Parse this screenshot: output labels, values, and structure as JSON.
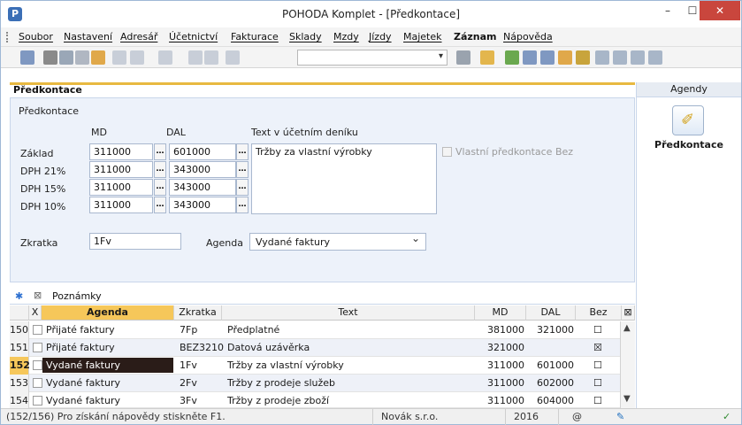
{
  "window": {
    "title": "POHODA Komplet - [Předkontace]",
    "min_label": "–",
    "max_label": "☐",
    "close_label": "✕"
  },
  "menu": [
    {
      "label": "Soubor"
    },
    {
      "label": "Nastavení"
    },
    {
      "label": "Adresář"
    },
    {
      "label": "Účetnictví"
    },
    {
      "label": "Fakturace"
    },
    {
      "label": "Sklady"
    },
    {
      "label": "Mzdy"
    },
    {
      "label": "Jízdy"
    },
    {
      "label": "Majetek"
    },
    {
      "label": "Záznam"
    },
    {
      "label": "Nápověda"
    }
  ],
  "section": {
    "title": "Předkontace",
    "subtitle": "Předkontace"
  },
  "form": {
    "col_md": "MD",
    "col_dal": "DAL",
    "col_text": "Text v účetním deníku",
    "rows": [
      {
        "label": "Základ",
        "md": "311000",
        "dal": "601000"
      },
      {
        "label": "DPH 21%",
        "md": "311000",
        "dal": "343000"
      },
      {
        "label": "DPH 15%",
        "md": "311000",
        "dal": "343000"
      },
      {
        "label": "DPH 10%",
        "md": "311000",
        "dal": "343000"
      }
    ],
    "text_value": "Tržby za vlastní výrobky",
    "own_bez_label": "Vlastní předkontace Bez",
    "zkratka_label": "Zkratka",
    "zkratka_value": "1Fv",
    "agenda_label": "Agenda",
    "agenda_value": "Vydané faktury",
    "dots": "…"
  },
  "sidebar": {
    "header": "Agendy",
    "item_label": "Předkontace"
  },
  "grid_tabs": {
    "star": "✱",
    "notes_label": "Poznámky"
  },
  "grid": {
    "headers": {
      "x": "X",
      "agenda": "Agenda",
      "zkratka": "Zkratka",
      "text": "Text",
      "md": "MD",
      "dal": "DAL",
      "bez": "Bez",
      "corner": "⊠"
    },
    "rows": [
      {
        "num": "150",
        "agenda": "Přijaté faktury",
        "zkratka": "7Fp",
        "text": "Předplatné",
        "md": "381000",
        "dal": "321000",
        "bez": "☐"
      },
      {
        "num": "151",
        "agenda": "Přijaté faktury",
        "zkratka": "BEZ3210",
        "text": "Datová uzávěrka",
        "md": "321000",
        "dal": "",
        "bez": "☒"
      },
      {
        "num": "152",
        "agenda": "Vydané faktury",
        "zkratka": "1Fv",
        "text": "Tržby za vlastní výrobky",
        "md": "311000",
        "dal": "601000",
        "bez": "☐"
      },
      {
        "num": "153",
        "agenda": "Vydané faktury",
        "zkratka": "2Fv",
        "text": "Tržby z prodeje služeb",
        "md": "311000",
        "dal": "602000",
        "bez": "☐"
      },
      {
        "num": "154",
        "agenda": "Vydané faktury",
        "zkratka": "3Fv",
        "text": "Tržby z prodeje zboží",
        "md": "311000",
        "dal": "604000",
        "bez": "☐"
      }
    ]
  },
  "status": {
    "hint": "(152/156) Pro získání nápovědy stiskněte F1.",
    "company": "Novák s.r.o.",
    "year": "2016",
    "at": "@",
    "ok": "✓"
  },
  "colors": {
    "accent": "#f6c75a",
    "selection": "#2a1c18",
    "panel_bg": "#edf2fa",
    "close_red": "#c9463d"
  }
}
